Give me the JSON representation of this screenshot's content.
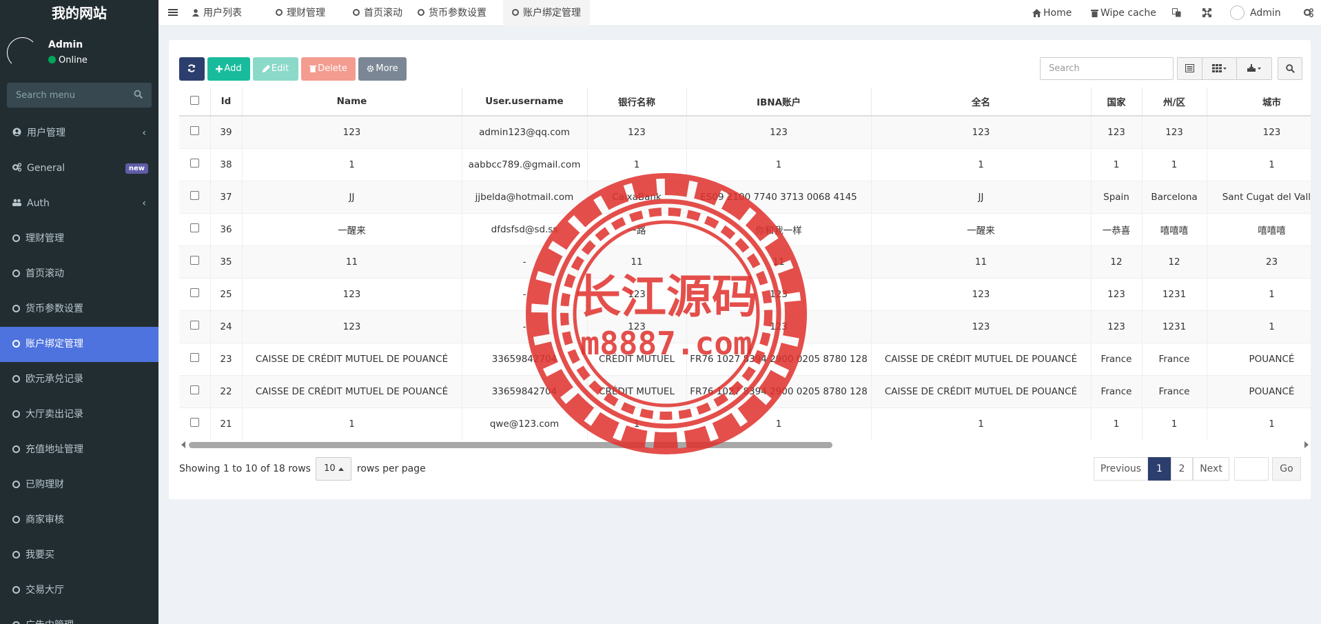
{
  "sidebar": {
    "logo": "我的网站",
    "user": {
      "name": "Admin",
      "status": "Online"
    },
    "search_placeholder": "Search menu",
    "items": [
      {
        "label": "用户管理",
        "icon": "user-circle-icon",
        "has_children": true
      },
      {
        "label": "General",
        "icon": "cogs-icon",
        "badge": "new"
      },
      {
        "label": "Auth",
        "icon": "users-icon",
        "has_children": true
      },
      {
        "label": "理财管理",
        "icon": "circle-icon"
      },
      {
        "label": "首页滚动",
        "icon": "circle-icon"
      },
      {
        "label": "货币参数设置",
        "icon": "circle-icon"
      },
      {
        "label": "账户绑定管理",
        "icon": "circle-icon",
        "active": true
      },
      {
        "label": "欧元承兑记录",
        "icon": "circle-icon"
      },
      {
        "label": "大厅卖出记录",
        "icon": "circle-icon"
      },
      {
        "label": "充值地址管理",
        "icon": "circle-icon"
      },
      {
        "label": "已购理财",
        "icon": "circle-icon"
      },
      {
        "label": "商家审核",
        "icon": "circle-icon"
      },
      {
        "label": "我要买",
        "icon": "circle-icon"
      },
      {
        "label": "交易大厅",
        "icon": "circle-icon"
      },
      {
        "label": "广告中管理",
        "icon": "circle-icon"
      }
    ]
  },
  "topnav": {
    "tabs": [
      {
        "label": "用户列表",
        "icon": "user-icon"
      },
      {
        "label": "理财管理",
        "icon": "circle-icon"
      },
      {
        "label": "首页滚动",
        "icon": "circle-icon"
      },
      {
        "label": "货币参数设置",
        "icon": "circle-icon"
      },
      {
        "label": "账户绑定管理",
        "icon": "circle-icon",
        "active": true
      }
    ],
    "home": "Home",
    "wipe_cache": "Wipe cache",
    "admin": "Admin"
  },
  "toolbar": {
    "add": "Add",
    "edit": "Edit",
    "delete": "Delete",
    "more": "More",
    "search_placeholder": "Search"
  },
  "table": {
    "headers": [
      "Id",
      "Name",
      "User.username",
      "银行名称",
      "IBNA账户",
      "全名",
      "国家",
      "州/区",
      "城市"
    ],
    "rows": [
      [
        "39",
        "123",
        "admin123@qq.com",
        "123",
        "123",
        "123",
        "123",
        "123",
        "123"
      ],
      [
        "38",
        "1",
        "aabbcc789.@gmail.com",
        "1",
        "1",
        "1",
        "1",
        "1",
        "1"
      ],
      [
        "37",
        "JJ",
        "jjbelda@hotmail.com",
        "CaixaBank",
        "ES09 2100 7740 3713 0068 4145",
        "JJ",
        "Spain",
        "Barcelona",
        "Sant Cugat del Vallès"
      ],
      [
        "36",
        "一醒来",
        "dfdsfsd@sd.ss",
        "一路",
        "你和我一样",
        "一醒来",
        "一恭喜",
        "嘻嘻嘻",
        "嘻嘻嘻"
      ],
      [
        "35",
        "11",
        "-",
        "11",
        "11",
        "11",
        "12",
        "12",
        "23"
      ],
      [
        "25",
        "123",
        "-",
        "123",
        "123",
        "123",
        "123",
        "1231",
        "1"
      ],
      [
        "24",
        "123",
        "-",
        "123",
        "123",
        "123",
        "123",
        "1231",
        "1"
      ],
      [
        "23",
        "CAISSE DE CRÉDIT MUTUEL DE POUANCÉ",
        "33659842704",
        "CRÉDIT MUTUEL",
        "FR76 1027 8394 2900 0205 8780 128",
        "CAISSE DE CRÉDIT MUTUEL DE POUANCÉ",
        "France",
        "France",
        "POUANCÉ"
      ],
      [
        "22",
        "CAISSE DE CRÉDIT MUTUEL DE POUANCÉ",
        "33659842704",
        "CRÉDIT MUTUEL",
        "FR76 1027 8394 2900 0205 8780 128",
        "CAISSE DE CRÉDIT MUTUEL DE POUANCÉ",
        "France",
        "France",
        "POUANCÉ"
      ],
      [
        "21",
        "1",
        "qwe@123.com",
        "1",
        "1",
        "1",
        "1",
        "1",
        "1"
      ]
    ]
  },
  "pagination": {
    "showing": "Showing 1 to 10 of 18 rows",
    "page_size": "10",
    "rows_per_page": "rows per page",
    "previous": "Previous",
    "pages": [
      "1",
      "2"
    ],
    "next": "Next",
    "go": "Go"
  },
  "watermark": {
    "title": "长江源码",
    "url": "m8887.com"
  },
  "colors": {
    "sidebar_bg": "#222d32",
    "active": "#4e73df",
    "primary": "#2c3e6e",
    "success": "#18bc9c",
    "danger": "#f39c8f",
    "stamp": "#e0312c"
  }
}
